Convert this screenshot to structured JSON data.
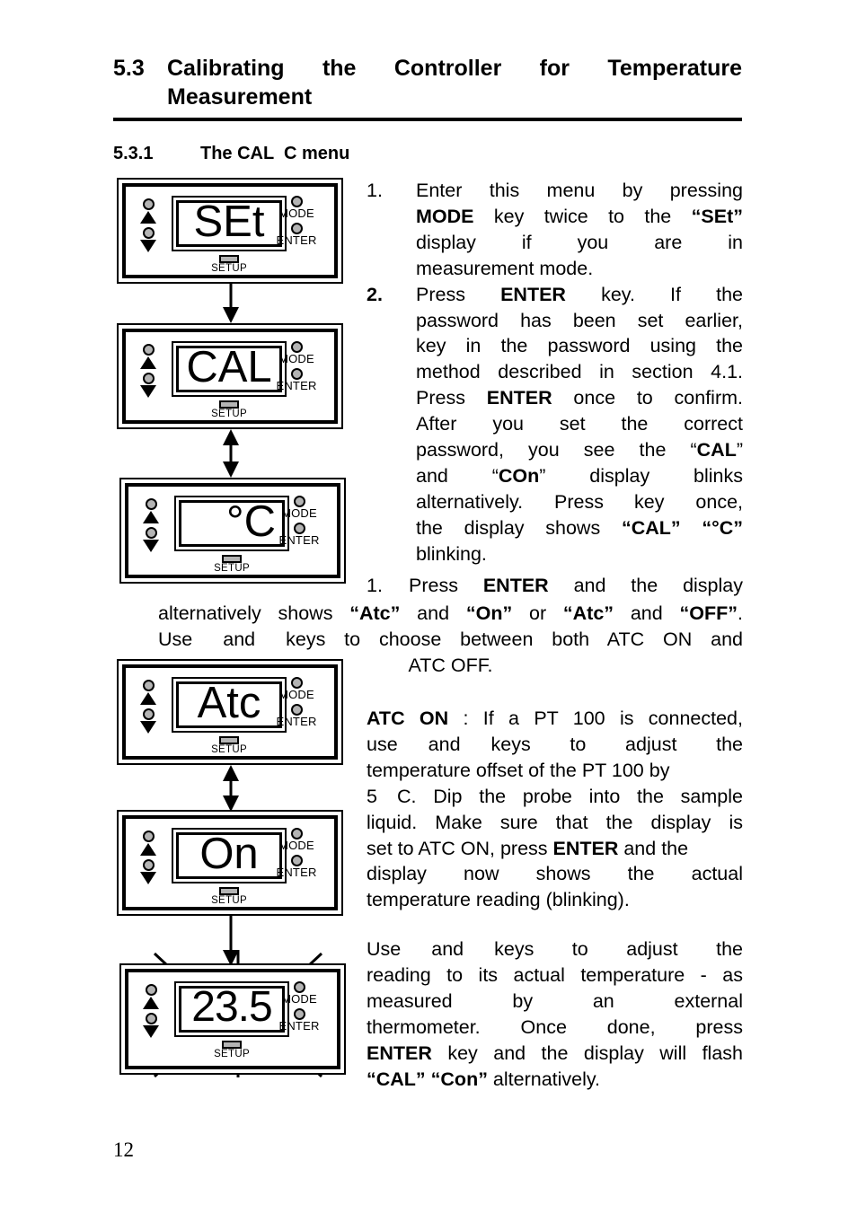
{
  "document": {
    "page_number": "12"
  },
  "headings": {
    "section_number": "5.3",
    "section_title_line1": "Calibrating the Controller for Temperature",
    "section_title_line2": "Measurement",
    "subsection_number": "5.3.1",
    "subsection_title": "The CAL  C menu"
  },
  "steps": [
    {
      "number": "1.",
      "bold_number": false,
      "lines": [
        "Enter this menu by pressing",
        "MODE key twice to the “SEt”",
        "display if you are in",
        "measurement mode."
      ]
    },
    {
      "number": "2.",
      "bold_number": true,
      "lines": [
        "Press ENTER key. If the",
        "password has been set earlier,",
        "key in the password using the",
        "method described in section 4.1.",
        "Press ENTER once to confirm.",
        "After you set the correct",
        "password, you see the “CAL”",
        "and “COn” display blinks",
        "alternatively. Press  key once,",
        "the display shows “CAL” “°C”",
        "blinking."
      ]
    }
  ],
  "wide_step": {
    "number": "1.",
    "lines": [
      "Press ENTER and the display",
      "alternatively shows “Atc” and “On” or “Atc” and “OFF”.",
      "Use  and  keys to choose between both ATC ON and",
      "ATC OFF."
    ]
  },
  "paragraphs": [
    {
      "id": "atc-on",
      "lines": [
        "ATC ON : If a PT 100 is connected,",
        "use  and  keys to adjust the",
        "temperature offset of the PT 100 by",
        "5  C. Dip the probe into the sample",
        "liquid. Make sure that the display is",
        "set to ATC ON, press ENTER and the",
        "display now shows the actual",
        "temperature reading (blinking)."
      ]
    },
    {
      "id": "adjust-reading",
      "lines": [
        "Use  and  keys to adjust the",
        "reading to its actual temperature - as",
        "measured by an external",
        "thermometer. Once done, press",
        "ENTER key and the display will flash",
        "“CAL” “Con” alternatively."
      ]
    }
  ],
  "panels": [
    {
      "id": "set",
      "display": "SEt",
      "align": "center",
      "setup_label": "SETUP",
      "mode_label": "MODE",
      "enter_label": "ENTER",
      "blinking": false
    },
    {
      "id": "cal",
      "display": "CAL",
      "align": "center",
      "setup_label": "SETUP",
      "mode_label": "MODE",
      "enter_label": "ENTER",
      "blinking": false
    },
    {
      "id": "degc",
      "display": "°C",
      "align": "right",
      "setup_label": "SETUP",
      "mode_label": "MODE",
      "enter_label": "ENTER",
      "blinking": false
    },
    {
      "id": "atc",
      "display": "Atc",
      "align": "center",
      "setup_label": "SETUP",
      "mode_label": "MODE",
      "enter_label": "ENTER",
      "blinking": false
    },
    {
      "id": "on",
      "display": "On",
      "align": "center",
      "setup_label": "SETUP",
      "mode_label": "MODE",
      "enter_label": "ENTER",
      "blinking": false
    },
    {
      "id": "temp",
      "display": "23.5",
      "align": "center",
      "setup_label": "SETUP",
      "mode_label": "MODE",
      "enter_label": "ENTER",
      "blinking": true
    }
  ],
  "connectors": [
    {
      "id": "set-to-cal",
      "direction": "down"
    },
    {
      "id": "cal-to-degc",
      "direction": "both"
    },
    {
      "id": "atc-to-on",
      "direction": "both"
    },
    {
      "id": "on-to-temp",
      "direction": "down"
    }
  ],
  "colors": {
    "ink": "#000000",
    "paper": "#ffffff",
    "led_fill": "#b4b4b4"
  }
}
